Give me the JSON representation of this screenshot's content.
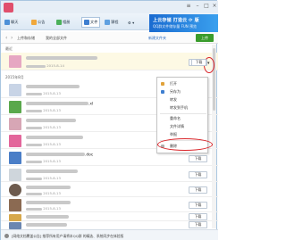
{
  "toolbar": {
    "chat_label": "聊天",
    "announce_label": "公告",
    "album_label": "相册",
    "files_label": "文件",
    "course_label": "课程",
    "more_label": "⚙ ▾"
  },
  "banner": {
    "line1": "上云存储 打造云 ⟳ 版",
    "line2": "QQ群文件储存量 FUN 预览"
  },
  "nav": {
    "crumb_root": "上传和存储",
    "crumb_all": "我的全部文件",
    "new_folder_label": "新建文件夹",
    "upload_label": "上传"
  },
  "sections": {
    "recent": "最近",
    "month": "2015年8月"
  },
  "files": [
    {
      "name": "",
      "meta": "2015-8-14",
      "thumb_color": "#e6a7c2"
    },
    {
      "name": "",
      "meta": "2015-8-13",
      "thumb_color": "#c8d4e6"
    },
    {
      "name": ".xl",
      "meta": "2015-8-13",
      "thumb_color": "#5aa84c"
    },
    {
      "name": "",
      "meta": "2015-8-13",
      "thumb_color": "#d7a6b5"
    },
    {
      "name": "",
      "meta": "2015-8-13",
      "thumb_color": "#e3669b"
    },
    {
      "name": ".doc",
      "meta": "2015-8-13",
      "thumb_color": "#4a7ec7"
    },
    {
      "name": "",
      "meta": "2015-8-13",
      "thumb_color": "#cfd6dc"
    },
    {
      "name": "",
      "meta": "2015-8-13",
      "thumb_color": "#6d5b4e"
    },
    {
      "name": "",
      "meta": "2015-8-13",
      "thumb_color": "#8b6a52"
    },
    {
      "name": "",
      "meta": "2015-8-13",
      "thumb_color": "#d7a84b"
    },
    {
      "name": "",
      "meta": "",
      "thumb_color": "#6a86b0"
    }
  ],
  "download_label": "下载",
  "context_menu": {
    "items": [
      "打开",
      "另存为",
      "转发",
      "转发到手机",
      "重命名",
      "文件详情",
      "举报",
      "删除"
    ]
  },
  "statusbar": {
    "text": "[网络文档覆盖公告] 推荐所有用户请将本QQ群 的精选、系统同步在体验版 "
  },
  "colors": {
    "accent": "#2b6cc0",
    "upload": "#3a9c2c",
    "highlight_ring": "#d9262b"
  }
}
